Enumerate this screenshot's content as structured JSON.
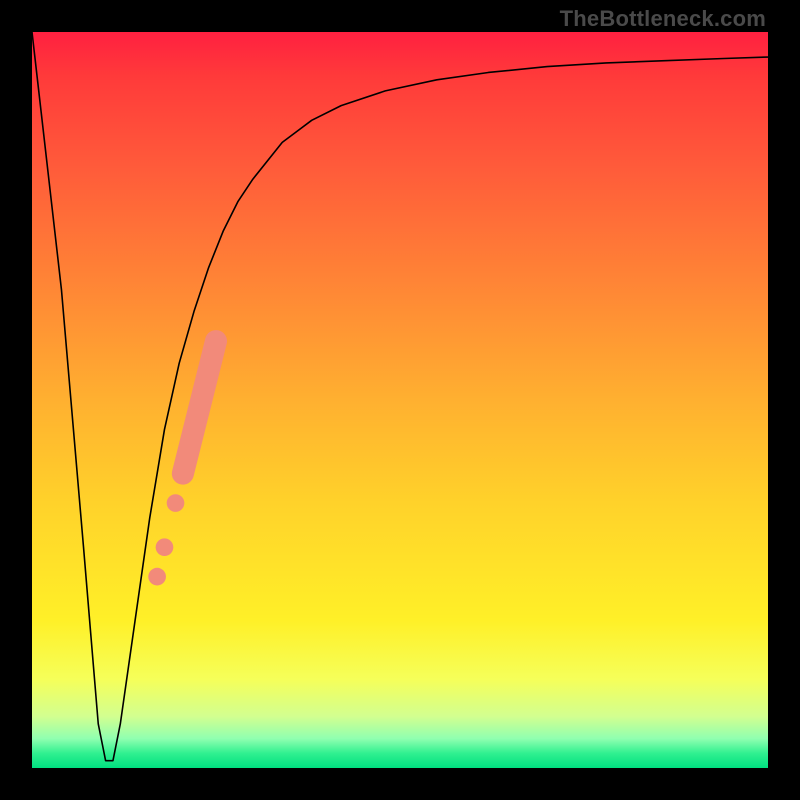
{
  "watermark": "TheBottleneck.com",
  "colors": {
    "curve": "#000000",
    "marker": "#f28a7a",
    "bg_black": "#000000"
  },
  "chart_data": {
    "type": "line",
    "title": "",
    "xlabel": "",
    "ylabel": "",
    "xlim": [
      0,
      100
    ],
    "ylim": [
      0,
      100
    ],
    "grid": false,
    "series": [
      {
        "name": "bottleneck-curve",
        "x": [
          0,
          4,
          7,
          9,
          10,
          11,
          12,
          14,
          16,
          18,
          20,
          22,
          24,
          26,
          28,
          30,
          34,
          38,
          42,
          48,
          55,
          62,
          70,
          78,
          86,
          94,
          100
        ],
        "y": [
          100,
          65,
          30,
          6,
          1,
          1,
          6,
          20,
          34,
          46,
          55,
          62,
          68,
          73,
          77,
          80,
          85,
          88,
          90,
          92,
          93.5,
          94.5,
          95.3,
          95.8,
          96.1,
          96.4,
          96.6
        ]
      }
    ],
    "markers": [
      {
        "name": "marker-dot-1",
        "x": 17.0,
        "y": 26.0,
        "r": 1.2
      },
      {
        "name": "marker-dot-2",
        "x": 18.0,
        "y": 30.0,
        "r": 1.2
      },
      {
        "name": "marker-dot-3",
        "x": 19.5,
        "y": 36.0,
        "r": 1.2
      },
      {
        "name": "marker-segment",
        "x1": 20.5,
        "y1": 40.0,
        "x2": 25.0,
        "y2": 58.0,
        "w": 3.0
      }
    ]
  }
}
